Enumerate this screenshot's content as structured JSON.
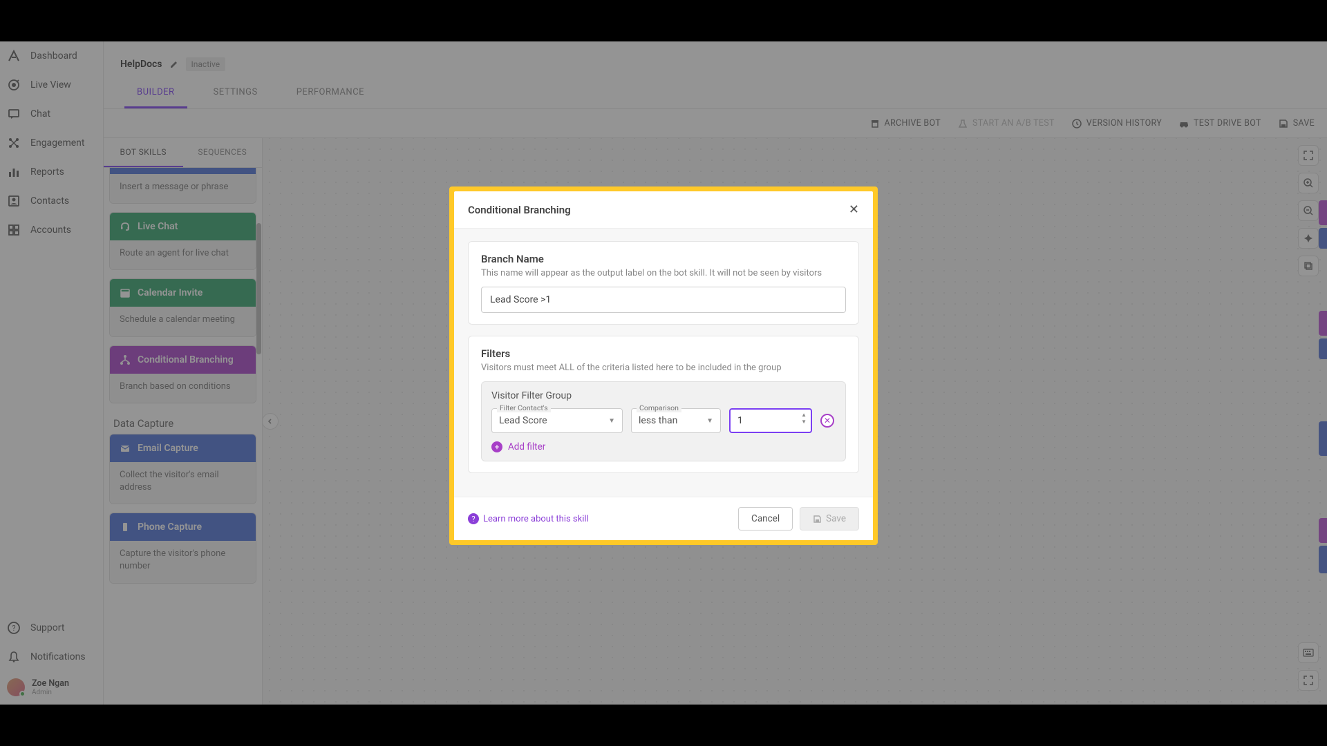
{
  "nav": {
    "items": [
      {
        "label": "Dashboard",
        "icon": "logo"
      },
      {
        "label": "Live View",
        "icon": "eye"
      },
      {
        "label": "Chat",
        "icon": "chat"
      },
      {
        "label": "Engagement",
        "icon": "engagement"
      },
      {
        "label": "Reports",
        "icon": "bars"
      },
      {
        "label": "Contacts",
        "icon": "contact"
      },
      {
        "label": "Accounts",
        "icon": "grid"
      }
    ],
    "support": "Support",
    "notifications": "Notifications",
    "user": {
      "name": "Zoe Ngan",
      "role": "Admin"
    }
  },
  "header": {
    "bot_name": "HelpDocs",
    "status_badge": "Inactive",
    "tabs": [
      "BUILDER",
      "SETTINGS",
      "PERFORMANCE"
    ],
    "toolbar": {
      "archive": "ARCHIVE BOT",
      "abtest": "START AN A/B TEST",
      "version": "VERSION HISTORY",
      "testdrive": "TEST DRIVE BOT",
      "save": "SAVE"
    }
  },
  "skills": {
    "tabs": [
      "BOT SKILLS",
      "SEQUENCES"
    ],
    "cards": [
      {
        "title_partial": "",
        "desc": "Insert a message or phrase",
        "color": "blue"
      },
      {
        "title": "Live Chat",
        "desc": "Route an agent for live chat",
        "color": "green"
      },
      {
        "title": "Calendar Invite",
        "desc": "Schedule a calendar meeting",
        "color": "green"
      },
      {
        "title": "Conditional Branching",
        "desc": "Branch based on conditions",
        "color": "purple"
      }
    ],
    "section_title": "Data Capture",
    "capture_cards": [
      {
        "title": "Email Capture",
        "desc": "Collect the visitor's email address",
        "color": "blue"
      },
      {
        "title": "Phone Capture",
        "desc": "Capture the visitor's phone number",
        "color": "blue"
      }
    ]
  },
  "modal": {
    "title": "Conditional Branching",
    "branch": {
      "heading": "Branch Name",
      "hint": "This name will appear as the output label on the bot skill. It will not be seen by visitors",
      "value": "Lead Score >1"
    },
    "filters": {
      "heading": "Filters",
      "hint": "Visitors must meet ALL of the criteria listed here to be included in the group",
      "group_title": "Visitor Filter Group",
      "contact_label": "Filter Contact's",
      "contact_value": "Lead Score",
      "comparison_label": "Comparison",
      "comparison_value": "less than",
      "number_value": "1",
      "add_filter": "Add filter"
    },
    "learn": "Learn more about this skill",
    "cancel": "Cancel",
    "save": "Save"
  }
}
